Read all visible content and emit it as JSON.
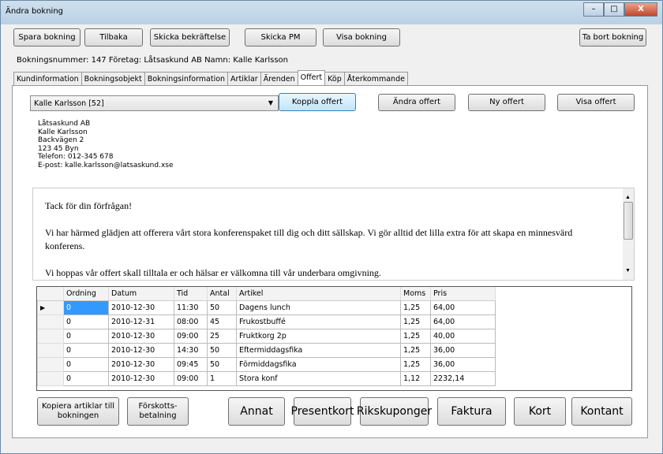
{
  "window": {
    "title": "Ändra bokning",
    "minimize": "–",
    "maximize": "□",
    "close": "X"
  },
  "toolbar": {
    "save": "Spara bokning",
    "back": "Tilbaka",
    "send_confirmation": "Skicka bekräftelse",
    "send_pm": "Skicka PM",
    "show_booking": "Visa bokning",
    "delete_booking": "Ta bort bokning"
  },
  "info": "Bokningsnummer: 147  Företag: Låtsaskund AB  Namn: Kalle Karlsson",
  "tabs": [
    "Kundinformation",
    "Bokningsobjekt",
    "Bokningsinformation",
    "Artiklar",
    "Ärenden",
    "Offert",
    "Köp",
    "Återkommande"
  ],
  "active_tab": "Offert",
  "offer": {
    "combo_value": "Kalle Karlsson [52]",
    "connect": "Koppla offert",
    "edit": "Ändra offert",
    "new": "Ny offert",
    "show": "Visa offert"
  },
  "address": [
    "Låtsaskund AB",
    "Kalle Karlsson",
    "Backvägen 2",
    "123 45 Byn",
    "Telefon: 012-345 678",
    "E-post: kalle.karlsson@latsaskund.xse"
  ],
  "letter": [
    "Tack för din förfrågan!",
    "Vi har härmed glädjen att offerera vårt stora konferenspaket till dig och ditt sällskap. Vi gör alltid det lilla extra för att skapa en minnesvärd konferens.",
    "Vi hoppas vår offert skall tilltala er och hälsar er välkomna till vår underbara omgivning."
  ],
  "grid": {
    "columns": [
      "Ordning",
      "Datum",
      "Tid",
      "Antal",
      "Artikel",
      "Moms",
      "Pris"
    ],
    "rows": [
      [
        "0",
        "2010-12-30",
        "11:30",
        "50",
        "Dagens lunch",
        "1,25",
        "64,00"
      ],
      [
        "0",
        "2010-12-31",
        "08:00",
        "45",
        "Frukostbuffé",
        "1,25",
        "64,00"
      ],
      [
        "0",
        "2010-12-30",
        "09:00",
        "25",
        "Fruktkorg 2p",
        "1,25",
        "40,00"
      ],
      [
        "0",
        "2010-12-30",
        "14:30",
        "50",
        "Eftermiddagsfika",
        "1,25",
        "36,00"
      ],
      [
        "0",
        "2010-12-30",
        "09:45",
        "50",
        "Förmiddagsfika",
        "1,25",
        "36,00"
      ],
      [
        "0",
        "2010-12-30",
        "09:00",
        "1",
        "Stora konf",
        "1,12",
        "2232,14"
      ]
    ]
  },
  "bottom": {
    "copy": "Kopiera artiklar till bokningen",
    "prepay": "Förskotts-betalning",
    "other": "Annat",
    "giftcard": "Presentkort",
    "rikskuponger": "Rikskuponger",
    "invoice": "Faktura",
    "card": "Kort",
    "cash": "Kontant"
  }
}
